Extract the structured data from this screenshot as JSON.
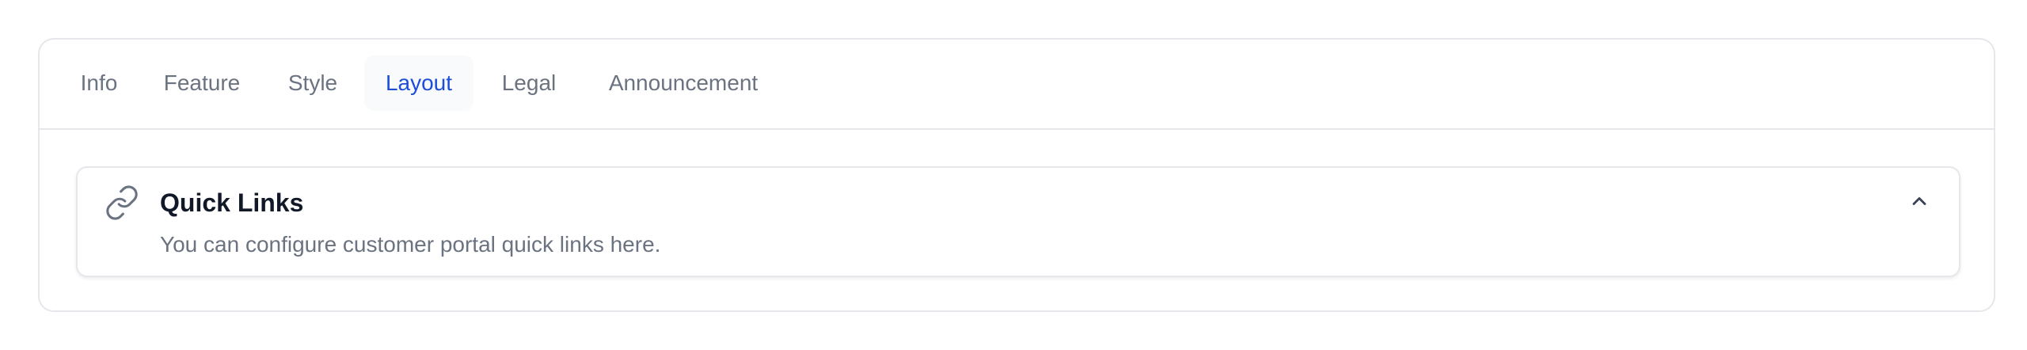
{
  "tabs": [
    {
      "label": "Info",
      "active": false
    },
    {
      "label": "Feature",
      "active": false
    },
    {
      "label": "Style",
      "active": false
    },
    {
      "label": "Layout",
      "active": true
    },
    {
      "label": "Legal",
      "active": false
    },
    {
      "label": "Announcement",
      "active": false
    }
  ],
  "section": {
    "icon": "link-icon",
    "title": "Quick Links",
    "subtitle": "You can configure customer portal quick links here.",
    "toggle_icon": "chevron-up-icon",
    "expanded": true
  },
  "colors": {
    "active_tab_text": "#1d4ed8",
    "active_tab_bg": "#f9fafb",
    "inactive_tab_text": "#6b7280",
    "border": "#e5e7eb",
    "title_text": "#111827",
    "muted_text": "#6b7280"
  }
}
